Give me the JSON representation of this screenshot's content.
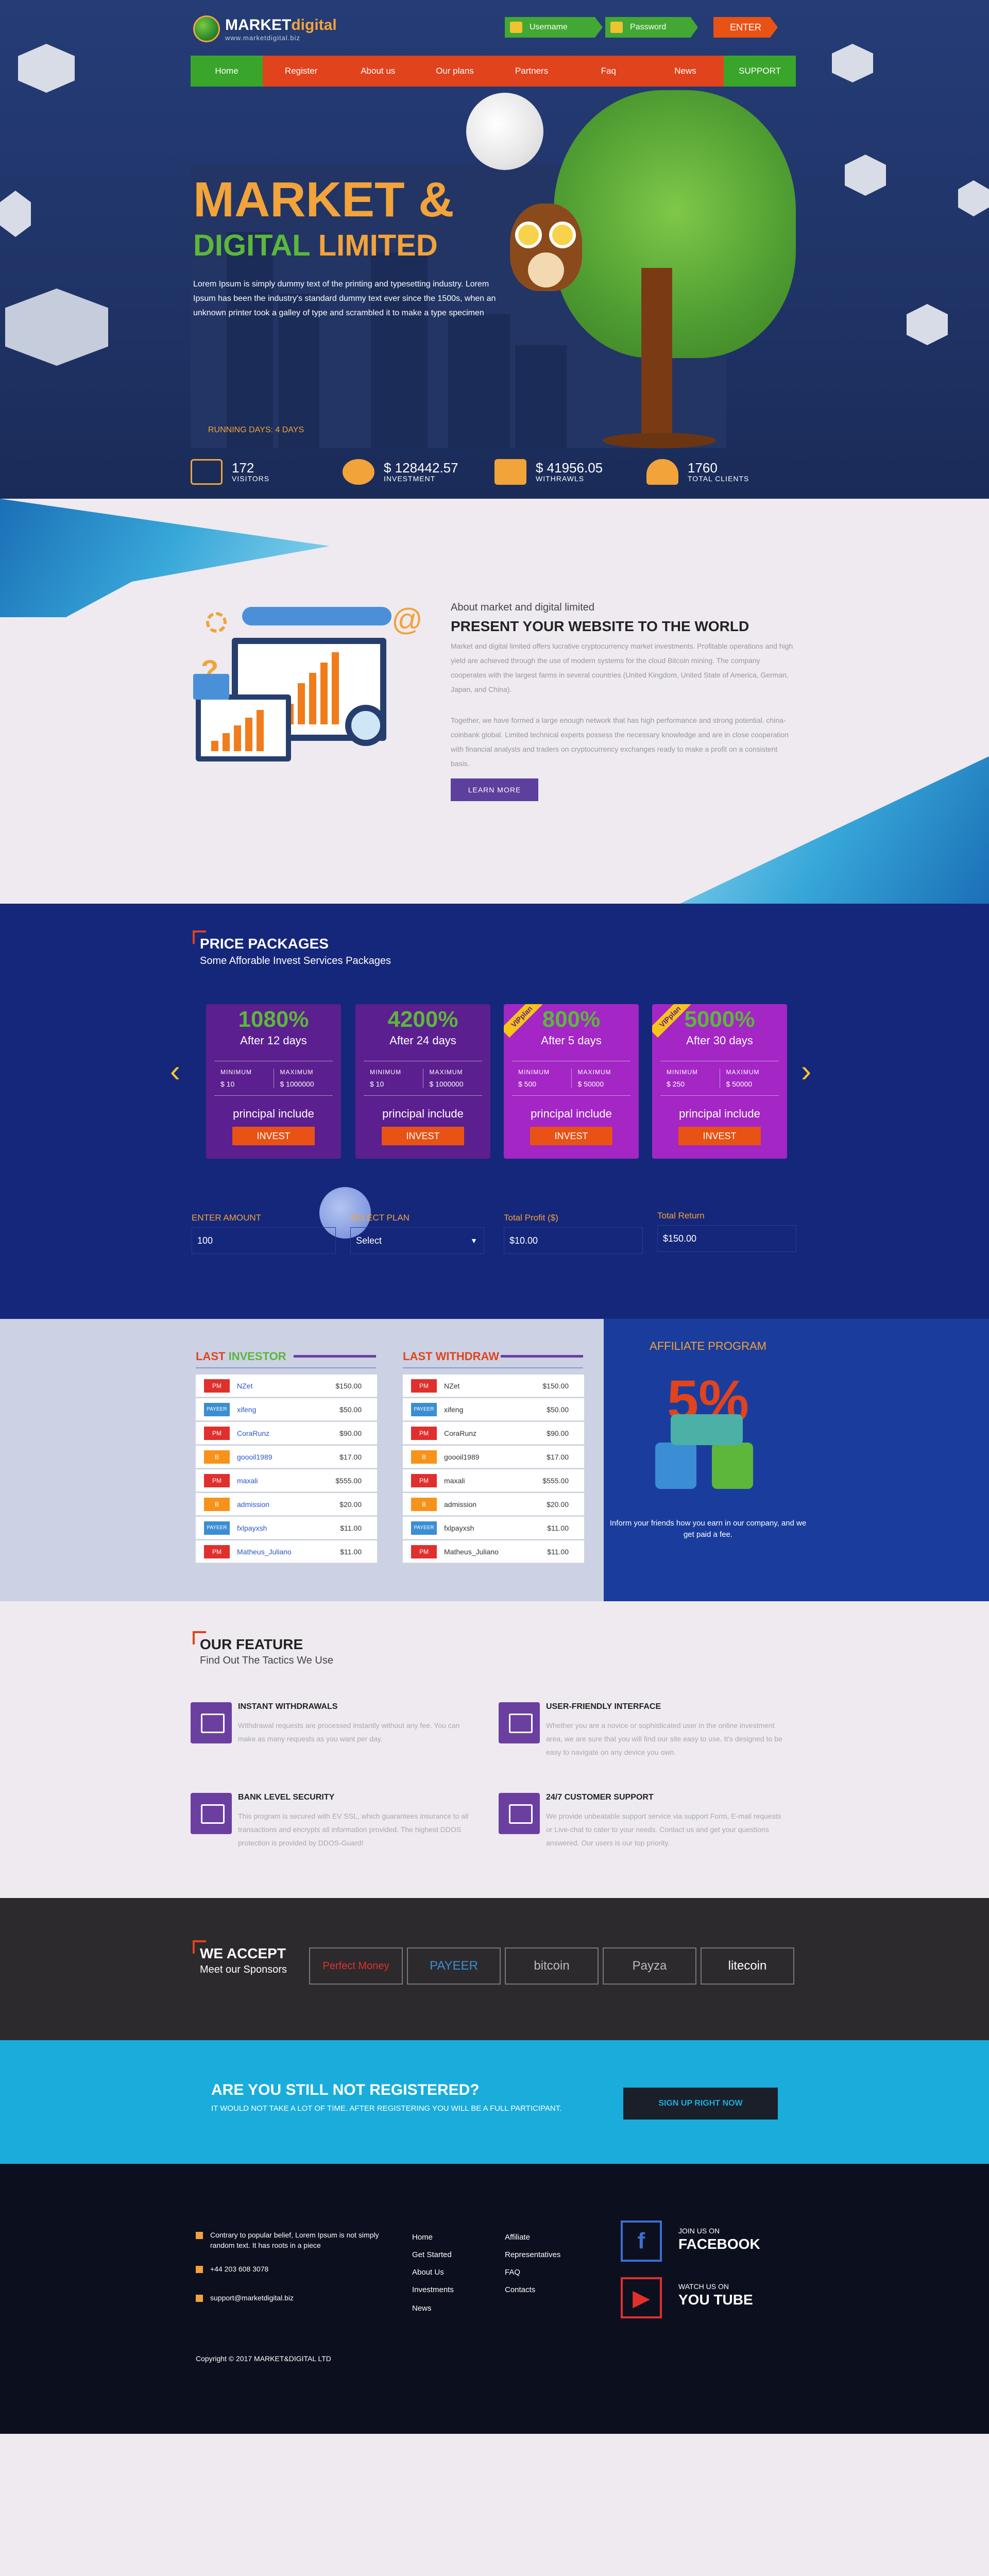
{
  "brand": {
    "name_a": "MARKET",
    "name_b": "digital",
    "site": "www.marketdigital.biz"
  },
  "login": {
    "username": "Username",
    "password": "Password",
    "enter": "ENTER"
  },
  "nav": [
    "Home",
    "Register",
    "About us",
    "Our plans",
    "Partners",
    "Faq",
    "News",
    "SUPPORT"
  ],
  "hero": {
    "title1": "MARKET &",
    "title2a": "DIGITAL",
    "title2b": "LIMITED",
    "text": "Lorem Ipsum is simply dummy text of the printing and typesetting industry. Lorem Ipsum has been the industry's standard dummy text ever since the 1500s, when an unknown printer took a galley of type and scrambled it to make a type specimen",
    "running": "RUNNING DAYS: 4 DAYS"
  },
  "stats": [
    {
      "num": "172",
      "label": "VISITORS"
    },
    {
      "num": "$ 128442.57",
      "label": "INVESTMENT"
    },
    {
      "num": "$ 41956.05",
      "label": "WITHRAWLS"
    },
    {
      "num": "1760",
      "label": "TOTAL CLIENTS"
    }
  ],
  "about": {
    "sub": "About market and digital limited",
    "title": "PRESENT YOUR WEBSITE TO THE WORLD",
    "p1": "Market and digital limited offers lucrative cryptocurrency market investments. Profitable operations and high yield are achieved through the use of modern systems for the cloud Bitcoin mining. The company cooperates with the largest farms in several countries (United Kingdom, United State of America, German, Japan, and China).",
    "p2": "Together, we have formed a large enough network that has high performance and strong potential. china-coinbank global. Limited technical experts possess the necessary knowledge and are in close cooperation with financial analysts and traders on cryptocurrency exchanges ready to make a profit on a consistent basis.",
    "button": "LEARN MORE"
  },
  "price": {
    "title": "PRICE PACKAGES",
    "subtitle": "Some Afforable Invest Services Packages",
    "packages": [
      {
        "pct": "1080%",
        "after": "After 12 days",
        "min": "$ 10",
        "max": "$ 1000000",
        "principal": "principal include",
        "button": "INVEST",
        "vip": ""
      },
      {
        "pct": "4200%",
        "after": "After 24 days",
        "min": "$ 10",
        "max": "$ 1000000",
        "principal": "principal include",
        "button": "INVEST",
        "vip": ""
      },
      {
        "pct": "800%",
        "after": "After 5 days",
        "min": "$ 500",
        "max": "$ 50000",
        "principal": "principal include",
        "button": "INVEST",
        "vip": "VIPplan"
      },
      {
        "pct": "5000%",
        "after": "After 30 days",
        "min": "$ 250",
        "max": "$ 50000",
        "principal": "principal include",
        "button": "INVEST",
        "vip": "VIPplan"
      }
    ],
    "min_label": "MINIMUM",
    "max_label": "MAXIMUM",
    "calc": {
      "amount_label": "ENTER AMOUNT",
      "amount": "100",
      "plan_label": "SELECT PLAN",
      "plan": "Select",
      "profit_label": "Total Profit ($)",
      "profit": "$10.00",
      "return_label": "Total Return",
      "return": "$150.00"
    }
  },
  "investor": {
    "title_a": "LAST",
    "title_b": "INVESTOR",
    "rows": [
      [
        "PM",
        "NZet",
        "$150.00"
      ],
      [
        "PAYEER",
        "xifeng",
        "$50.00"
      ],
      [
        "PM",
        "CoraRunz",
        "$90.00"
      ],
      [
        "B",
        "goooil1989",
        "$17.00"
      ],
      [
        "PM",
        "maxali",
        "$555.00"
      ],
      [
        "B",
        "admission",
        "$20.00"
      ],
      [
        "PAYEER",
        "fxlpayxsh",
        "$11.00"
      ],
      [
        "PM",
        "Matheus_Juliano",
        "$11.00"
      ]
    ]
  },
  "withdraw": {
    "title_a": "LAST",
    "title_b": "WITHDRAW",
    "rows": [
      [
        "PM",
        "NZet",
        "$150.00"
      ],
      [
        "PAYEER",
        "xifeng",
        "$50.00"
      ],
      [
        "PM",
        "CoraRunz",
        "$90.00"
      ],
      [
        "B",
        "goooil1989",
        "$17.00"
      ],
      [
        "PM",
        "maxali",
        "$555.00"
      ],
      [
        "B",
        "admission",
        "$20.00"
      ],
      [
        "PAYEER",
        "fxlpayxsh",
        "$11.00"
      ],
      [
        "PM",
        "Matheus_Juliano",
        "$11.00"
      ]
    ]
  },
  "affiliate": {
    "title": "AFFILIATE PROGRAM",
    "pct": "5%",
    "text": "Inform your friends how you earn in our company, and we get paid a fee."
  },
  "feature": {
    "title": "OUR FEATURE",
    "subtitle": "Find Out The Tactics We Use",
    "items": [
      {
        "t": "INSTANT WITHDRAWALS",
        "d": "Withdrawal requests are processed instantly without any fee. You can make as many requests as you want per day."
      },
      {
        "t": "USER-FRIENDLY INTERFACE",
        "d": "Whether you are a novice or sophisticated user in the online investment area, we are sure that you will find our site easy to use. It's designed to be easy to navigate on any device you own."
      },
      {
        "t": "BANK LEVEL SECURITY",
        "d": "This program is secured with EV SSL, which guarantees insurance to all transactions and encrypts all information provided. The highest DDOS protection is provided by DDOS-Guard!"
      },
      {
        "t": "24/7 CUSTOMER SUPPORT",
        "d": "We provide unbeatable support service via support Form, E-mail requests or Live-chat to cater to your needs. Contact us and get your questions answered. Our users is our top priority."
      }
    ]
  },
  "accept": {
    "title": "WE ACCEPT",
    "subtitle": "Meet our Sponsors",
    "items": [
      "Perfect Money",
      "PAYEER",
      "bitcoin",
      "Payza",
      "litecoin"
    ]
  },
  "register": {
    "title": "ARE YOU STILL NOT REGISTERED?",
    "text": "IT WOULD NOT TAKE A LOT OF TIME. AFTER REGISTERING YOU WILL BE A FULL PARTICIPANT.",
    "button": "SIGN UP RIGHT NOW"
  },
  "footer": {
    "address": "Contrary to popular belief, Lorem Ipsum is not simply random text. It has roots in a piece",
    "phone": "+44 203 608 3078",
    "email": "support@marketdigital.biz",
    "col1": [
      "Home",
      "Get Started",
      "About Us",
      "Investments",
      "News"
    ],
    "col2": [
      "Affiliate",
      "Representatives",
      "FAQ",
      "Contacts"
    ],
    "fb_small": "JOIN US ON",
    "fb": "FACEBOOK",
    "yt_small": "WATCH US ON",
    "yt": "YOU TUBE",
    "copyright": "Copyright © 2017 MARKET&DIGITAL LTD"
  },
  "colors": {
    "orange": "#f2a33a",
    "green": "#5cb73a",
    "red": "#e1431c",
    "navy": "#15277a",
    "purple": "#6b3fa0",
    "cyan": "#1aaddc"
  }
}
